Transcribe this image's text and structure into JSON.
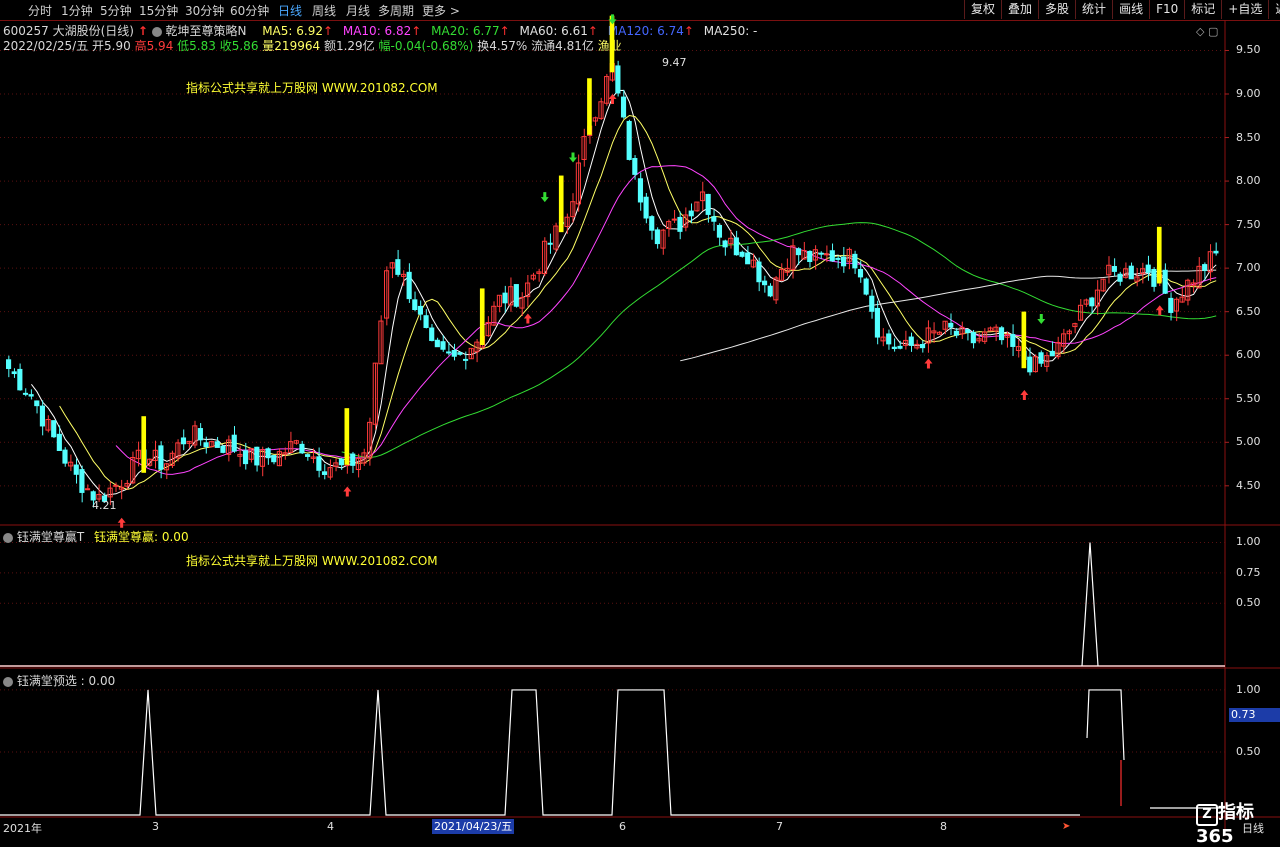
{
  "toolbar": {
    "left_items": [
      "分时",
      "1分钟",
      "5分钟",
      "15分钟",
      "30分钟",
      "60分钟",
      "日线",
      "周线",
      "月线",
      "多周期",
      "更多 >"
    ],
    "active": "日线",
    "right_items": [
      "复权",
      "叠加",
      "多股",
      "统计",
      "画线",
      "F10",
      "标记",
      "+自选",
      "返回"
    ]
  },
  "header": {
    "stock": "600257 大湖股份(日线)",
    "strategy": "乾坤至尊策略N",
    "ma5": "MA5: 6.92",
    "ma10": "MA10: 6.82",
    "ma20": "MA20: 6.77",
    "ma60": "MA60: 6.61",
    "ma120": "MA120: 6.74",
    "ma250": "MA250: -",
    "date": "2022/02/25/五",
    "open": "开5.90",
    "high": "高5.94",
    "low": "低5.83",
    "close": "收5.86",
    "volume": "量219964",
    "amount": "额1.29亿",
    "change": "幅-0.04(-0.68%)",
    "turnover": "换4.57%",
    "float": "流通4.81亿",
    "sector": "渔业"
  },
  "watermark": "指标公式共享就上万股网 WWW.201082.COM",
  "panel2": {
    "title": "钰满堂尊赢T",
    "value_label": "钰满堂尊赢: 0.00"
  },
  "panel3": {
    "title": "钰满堂预选 : 0.00"
  },
  "annotations": {
    "high": "9.47",
    "low": "4.21"
  },
  "cursor_value": "0.73",
  "x_axis": {
    "year": "2021年",
    "months": [
      "3",
      "4",
      "6",
      "7",
      "8"
    ],
    "cursor_date": "2021/04/23/五"
  },
  "bottom_right": {
    "period": "日线",
    "logo": "指标365"
  },
  "colors": {
    "up": "#ff3b3b",
    "down": "#54ffff",
    "ma5": "#ffffff",
    "ma10": "#ffff66",
    "ma20": "#ff44ff",
    "ma60": "#33dd33",
    "ma120": "#4466ff",
    "signal": "#ffff00"
  },
  "chart_data": [
    {
      "type": "candlestick",
      "title": "600257 大湖股份(日线)",
      "y_ticks": [
        9.5,
        9.0,
        8.5,
        8.0,
        7.5,
        7.0,
        6.5,
        6.0,
        5.5,
        5.0,
        4.5
      ],
      "ylim": [
        4.05,
        9.85
      ],
      "x_labels": [
        "2021年",
        "3",
        "4",
        "6",
        "7",
        "8"
      ],
      "close_trend": [
        5.85,
        5.55,
        5.05,
        4.6,
        4.35,
        4.55,
        4.85,
        4.75,
        5.1,
        5.0,
        4.95,
        4.8,
        4.85,
        5.0,
        4.75,
        4.7,
        4.9,
        7.2,
        6.7,
        6.0,
        5.95,
        6.2,
        6.65,
        6.7,
        7.2,
        7.6,
        8.7,
        9.3,
        8.0,
        7.4,
        7.5,
        7.9,
        7.3,
        7.2,
        6.75,
        7.2,
        7.1,
        7.15,
        7.1,
        6.2,
        6.05,
        6.2,
        6.3,
        6.15,
        6.25,
        6.05,
        5.85,
        6.1,
        6.5,
        6.9,
        6.95,
        7.0,
        6.6,
        6.9,
        7.15
      ]
    },
    {
      "type": "line",
      "title": "钰满堂尊赢T",
      "y_ticks": [
        1.0,
        0.75,
        0.5
      ],
      "series": [
        {
          "name": "钰满堂尊赢",
          "pulse_at": [
            0.89
          ]
        }
      ]
    },
    {
      "type": "line",
      "title": "钰满堂预选",
      "y_ticks": [
        1.0,
        0.5
      ],
      "series": [
        {
          "name": "钰满堂预选",
          "pulses": [
            [
              0.12,
              0.12
            ],
            [
              0.31,
              0.31
            ],
            [
              0.42,
              0.44
            ],
            [
              0.51,
              0.54
            ],
            [
              0.89,
              0.915
            ]
          ]
        }
      ]
    }
  ]
}
